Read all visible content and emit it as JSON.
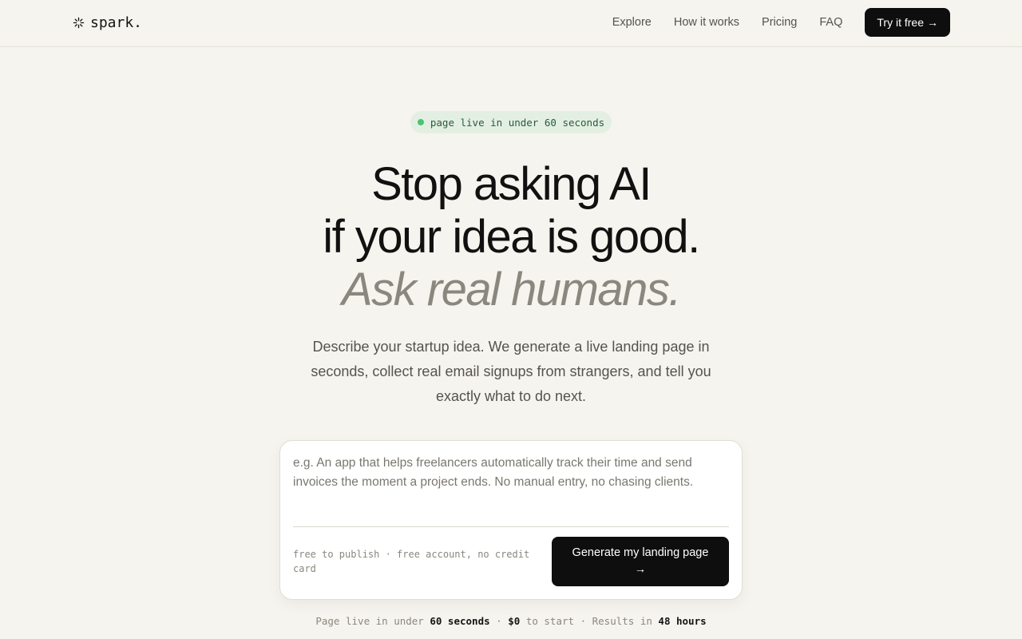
{
  "header": {
    "logo_text": "spark.",
    "logo_icon": "sparkle-icon",
    "nav": [
      {
        "label": "Explore"
      },
      {
        "label": "How it works"
      },
      {
        "label": "Pricing"
      },
      {
        "label": "FAQ"
      }
    ],
    "cta_label": "Try it free",
    "cta_arrow": "→"
  },
  "hero": {
    "badge_text": "page live in under 60 seconds",
    "badge_dot_color": "#4cc472",
    "headline_line1": "Stop asking AI",
    "headline_line2": "if your idea is good.",
    "headline_line3": "Ask real humans.",
    "subtitle": "Describe your startup idea. We generate a live landing page in seconds, collect real email signups from strangers, and tell you exactly what to do next."
  },
  "form": {
    "input_value": "",
    "input_placeholder": "e.g. An app that helps freelancers automatically track their time and send invoices the moment a project ends. No manual entry, no chasing clients.",
    "note": "free to publish · free account, no credit card",
    "button_label": "Generate my landing page",
    "button_arrow": "→"
  },
  "stats": {
    "prefix": "Page live in under",
    "time_value": "60 seconds",
    "sep1": "·",
    "price_value": "$0",
    "price_suffix": "to start",
    "sep2": "·",
    "results_prefix": "Results in",
    "results_value": "48 hours"
  },
  "colors": {
    "background": "#f6f4ee",
    "primary": "#0e0e0e",
    "accent_muted": "#8a877e",
    "badge_bg": "#e3efe3"
  }
}
